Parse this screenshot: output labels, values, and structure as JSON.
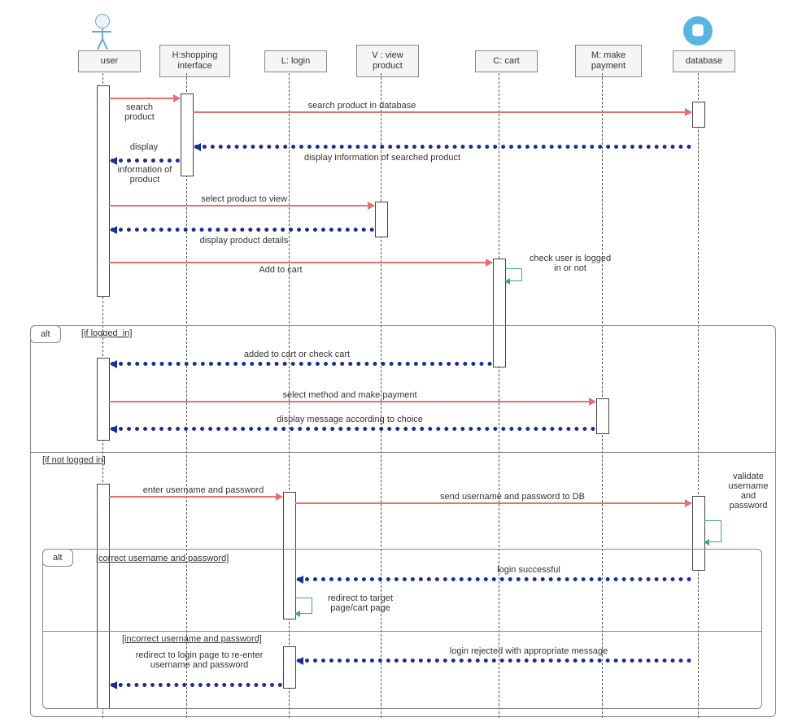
{
  "participants": {
    "user": "user",
    "shopping": "H:shopping interface",
    "login": "L: login",
    "view": "V : view product",
    "cart": "C: cart",
    "payment": "M: make payment",
    "db": "database"
  },
  "messages": {
    "m1": "search product",
    "m2": "search product in database",
    "m3": "display information of searched product",
    "m4": "display information of product",
    "m5": "select product to view",
    "m6": "display product details",
    "m7": "Add to cart",
    "m8": "check user is logged in or not",
    "m9": "added to cart or check cart",
    "m10": "select method and make payment",
    "m11": "display message according to choice",
    "m12": "enter username and password",
    "m13": "send username and password to DB",
    "m14": "validate username and password",
    "m15": "login successful",
    "m16": "redirect to target page/cart page",
    "m17": "login rejected with appropriate message",
    "m18": "redirect to login page to re-enter username and password"
  },
  "fragments": {
    "alt": "alt",
    "g1": "[if logged_in]",
    "g2": "[if not logged in]",
    "g3": "[correct username and password]",
    "g4": "[incorrect username and password]"
  }
}
